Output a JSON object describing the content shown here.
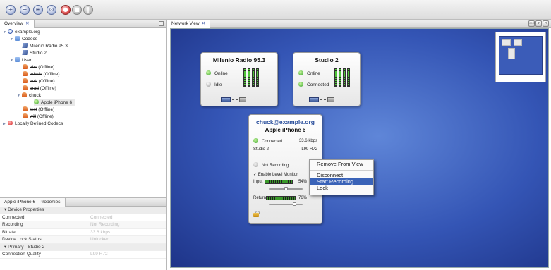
{
  "toolbar": {
    "buttons": [
      {
        "name": "zoom-in-icon",
        "glyph": "+"
      },
      {
        "name": "zoom-out-icon",
        "glyph": "−"
      },
      {
        "name": "zoom-fit-icon",
        "glyph": "⊕"
      },
      {
        "name": "zoom-reset-icon",
        "glyph": "⊙"
      },
      {
        "name": "record-icon",
        "glyph": "●"
      },
      {
        "name": "stop-icon",
        "glyph": "■"
      },
      {
        "name": "pause-icon",
        "glyph": "‖"
      }
    ]
  },
  "overview": {
    "tab_label": "Overview",
    "tab_close": "✕",
    "tree": {
      "root": "example.org",
      "codecs_folder": "Codecs",
      "codecs": [
        "Milenio Radio 95.3",
        "Studio 2"
      ],
      "user_folder": "User",
      "users": [
        {
          "name": "abc",
          "status": "(Offline)",
          "strike": true
        },
        {
          "name": "admin",
          "status": "(Offline)",
          "strike": true
        },
        {
          "name": "bob",
          "status": "(Offline)",
          "strike": true
        },
        {
          "name": "brad",
          "status": "(Offline)",
          "strike": true
        }
      ],
      "chuck": "chuck",
      "chuck_device": "Apple iPhone 6",
      "users_after": [
        {
          "name": "test",
          "status": "(Offline)",
          "strike": true
        },
        {
          "name": "will",
          "status": "(Offline)",
          "strike": true
        }
      ],
      "local_codecs": "Locally Defined Codecs"
    }
  },
  "properties": {
    "tab_label": "Apple iPhone 6 - Properties",
    "group1": "Device Properties",
    "rows": [
      {
        "key": "Connected",
        "value": "Connected"
      },
      {
        "key": "Recording",
        "value": "Not Recording"
      },
      {
        "key": "Bitrate",
        "value": "33.6 kbps"
      },
      {
        "key": "Device Lock Status",
        "value": "Unlocked"
      }
    ],
    "group2": "Primary - Studio 2",
    "rows2": [
      {
        "key": "Connection Quality",
        "value": "L99 R72"
      }
    ]
  },
  "network": {
    "tab_label": "Network View",
    "tab_close": "✕",
    "window_buttons": [
      "▭▭",
      "▾",
      "✕"
    ],
    "card1": {
      "title": "Milenio Radio 95.3",
      "status1": "Online",
      "status2": "Idle"
    },
    "card2": {
      "title": "Studio 2",
      "status1": "Online",
      "status2": "Connected"
    },
    "device": {
      "user": "chuck@example.org",
      "device": "Apple iPhone 6",
      "connection_status": "Connected",
      "bitrate": "33.6 kbps",
      "peer": "Studio 2",
      "quality": "L99 R72",
      "recording_status": "Not Recording",
      "level_monitor_check": "✓",
      "level_monitor_label": "Enable Level Monitor",
      "input_label": "Input",
      "input_pct": "54%",
      "input_level": 0.54,
      "return_label": "Return",
      "return_pct": "76%",
      "return_level": 0.76
    },
    "context_menu": {
      "items": [
        "Remove From View",
        "Disconnect",
        "Start Recording",
        "Lock"
      ],
      "highlighted": "Start Recording"
    }
  }
}
